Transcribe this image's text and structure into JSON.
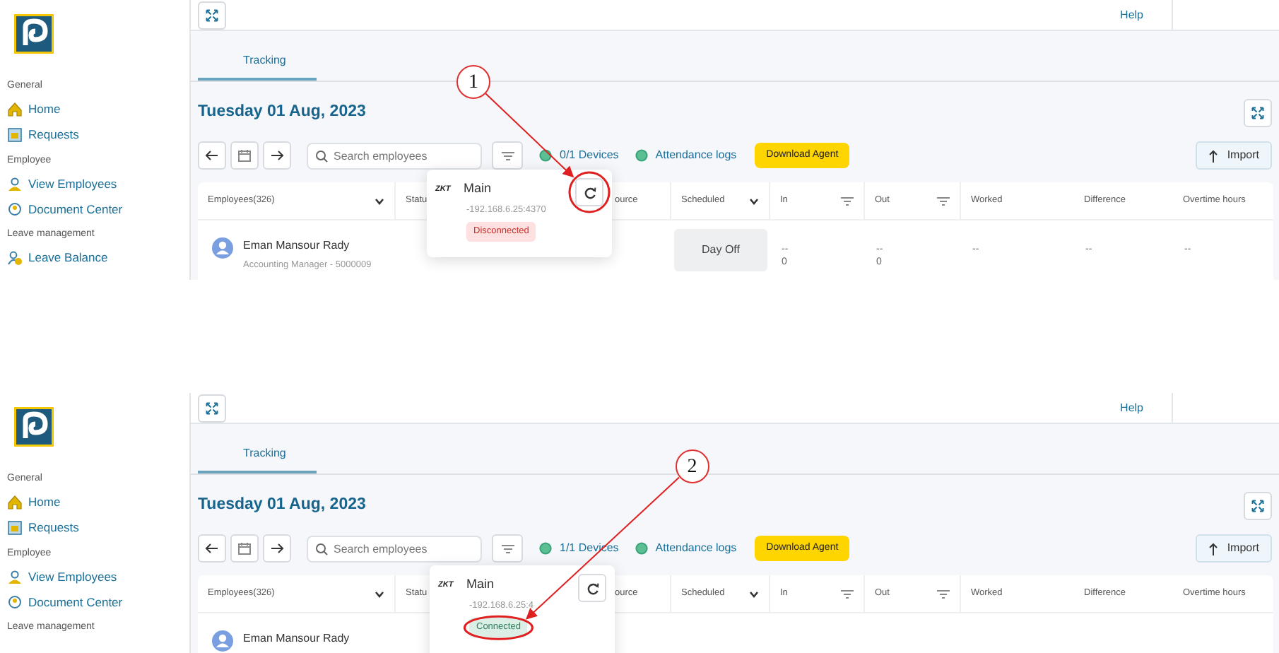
{
  "panels": [
    {
      "sidebar": [
        {
          "heading": "General",
          "items": [
            {
              "label": "Home"
            },
            {
              "label": "Requests"
            }
          ]
        },
        {
          "heading": "Employee",
          "items": [
            {
              "label": "View Employees"
            },
            {
              "label": "Document Center"
            }
          ]
        },
        {
          "heading": "Leave management",
          "items": [
            {
              "label": "Leave Balance"
            }
          ]
        }
      ],
      "help": "Help",
      "tabs": [
        {
          "label": "Tracking",
          "selected": true
        }
      ],
      "date": "Tuesday 01 Aug, 2023",
      "search": {
        "placeholder": "Search employees"
      },
      "devices": "0/1 Devices",
      "logs": "Attendance logs",
      "download": "Download Agent",
      "import": "Import",
      "columns": [
        "Employees(326)",
        "Statu",
        "",
        "ource",
        "Scheduled",
        "In",
        "Out",
        "Worked",
        "Difference",
        "Overtime hours"
      ],
      "rows": [
        {
          "cells": [
            [
              "Eman Mansour Rady",
              "Accounting Manager - 5000009"
            ],
            "",
            "",
            "",
            "Day Off",
            [
              "--",
              "0"
            ],
            [
              "--",
              "0"
            ],
            "--",
            "--",
            "--"
          ]
        }
      ],
      "popup": {
        "brand": "ZKT",
        "name": "Main",
        "address": "-192.168.6.25:4370",
        "status": "Disconnected",
        "connected": false
      },
      "annotation": {
        "number": "1",
        "kind": "refresh"
      }
    },
    {
      "sidebar": [
        {
          "heading": "General",
          "items": [
            {
              "label": "Home"
            },
            {
              "label": "Requests"
            }
          ]
        },
        {
          "heading": "Employee",
          "items": [
            {
              "label": "View Employees"
            },
            {
              "label": "Document Center"
            }
          ]
        },
        {
          "heading": "Leave management"
        }
      ],
      "help": "Help",
      "tabs": [
        {
          "label": "Tracking",
          "selected": true
        }
      ],
      "date": "Tuesday 01 Aug, 2023",
      "search": {
        "placeholder": "Search employees"
      },
      "devices": "1/1 Devices",
      "logs": "Attendance logs",
      "download": "Download Agent",
      "import": "Import",
      "columns": [
        "Employees(326)",
        "Statu",
        "",
        "ource",
        "Scheduled",
        "In",
        "Out",
        "Worked",
        "Difference",
        "Overtime hours"
      ],
      "rows": [
        {
          "cells": [
            [
              "Eman Mansour Rady"
            ]
          ]
        }
      ],
      "popup": {
        "brand": "ZKT",
        "name": "Main",
        "address": "-192.168.6.25:4",
        "status": "Connected",
        "connected": true
      },
      "annotation": {
        "number": "2",
        "kind": "status"
      }
    }
  ]
}
